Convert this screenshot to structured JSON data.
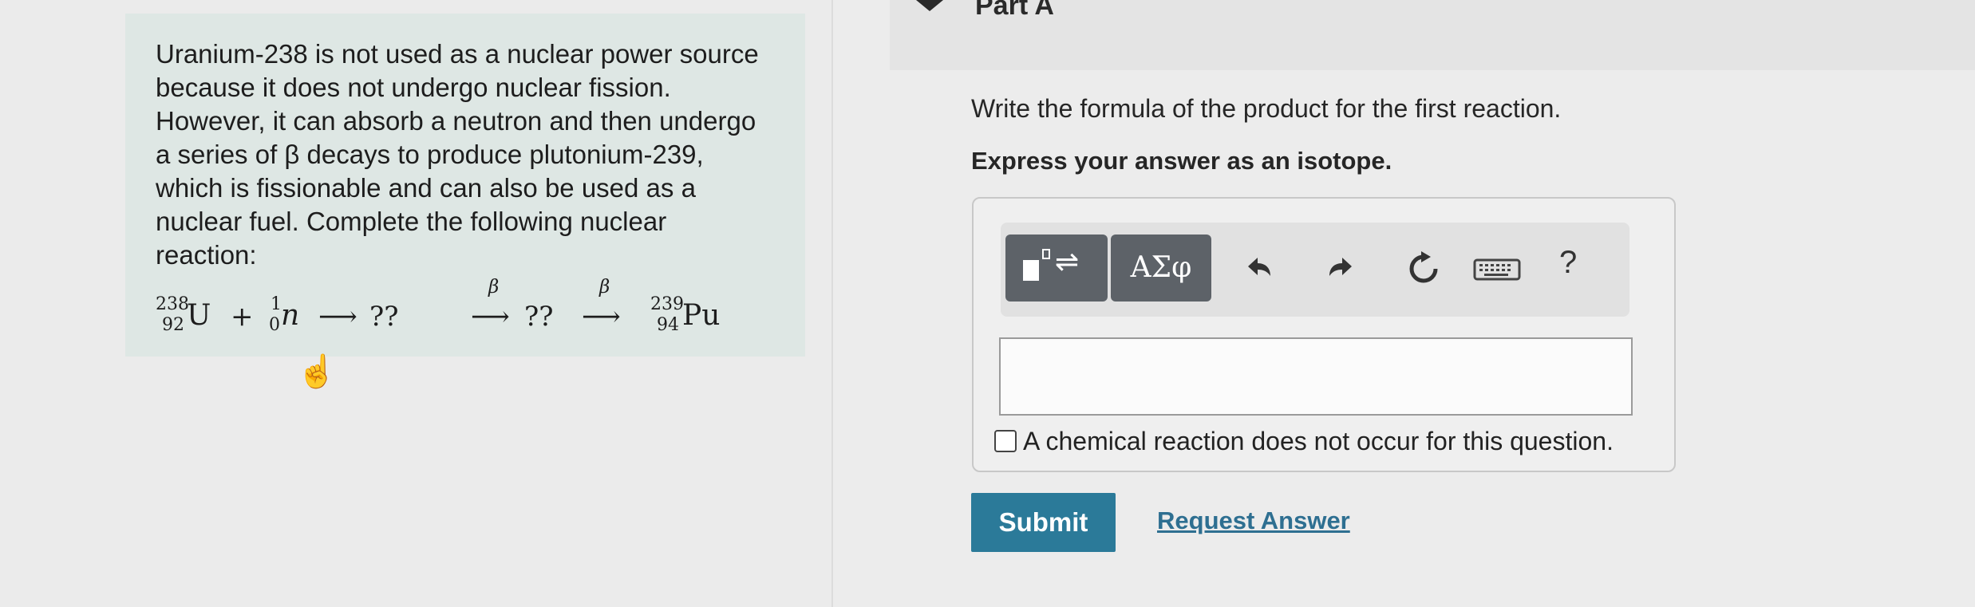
{
  "part": {
    "title": "Part A"
  },
  "problem": {
    "lines": [
      "Uranium-238 is not used as a nuclear power source",
      "because it does not undergo nuclear fission.",
      "However, it can absorb a neutron and then undergo",
      "a series of β decays to produce plutonium-239,",
      "which is fissionable and can also be used as a",
      "nuclear fuel. Complete the following nuclear",
      "reaction:"
    ],
    "reaction": {
      "u_mass": "238",
      "u_atomic": "92",
      "u_symbol": "U",
      "plus": "+",
      "n_mass": "1",
      "n_atomic": "0",
      "n_symbol": "n",
      "arrow": "⟶",
      "unknown1": "??",
      "beta1": "β",
      "unknown2": "??",
      "beta2": "β",
      "pu_mass": "239",
      "pu_atomic": "94",
      "pu_symbol": "Pu"
    }
  },
  "question": {
    "prompt": "Write the formula of the product for the first reaction.",
    "instruction": "Express your answer as an isotope."
  },
  "toolbar": {
    "template_icon": "templates-icon",
    "greek_label": "ΑΣφ",
    "undo_icon": "undo-icon",
    "redo_icon": "redo-icon",
    "reset_icon": "reset-icon",
    "keyboard_icon": "keyboard-icon",
    "help_label": "?"
  },
  "answer": {
    "value": ""
  },
  "no_reaction": {
    "label": "A chemical reaction does not occur for this question.",
    "checked": false
  },
  "actions": {
    "submit_label": "Submit",
    "request_label": "Request Answer"
  },
  "colors": {
    "submit_bg": "#2b7a99",
    "link": "#2e6f91",
    "problem_bg": "#dee7e4"
  }
}
